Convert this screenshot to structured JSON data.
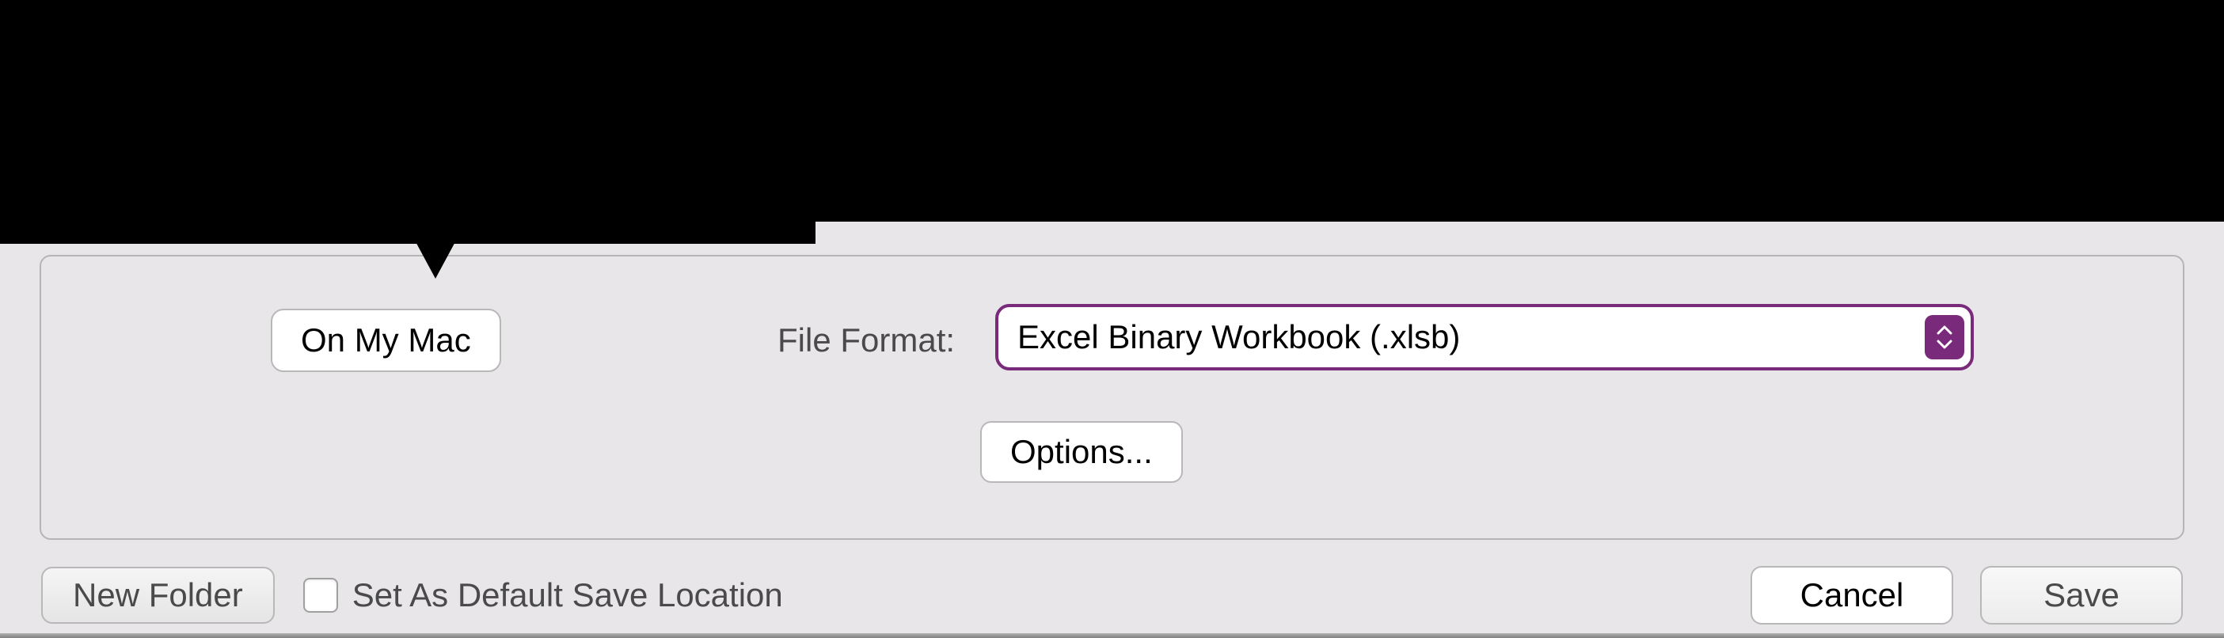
{
  "dialog": {
    "on_my_mac_label": "On My Mac",
    "file_format_label": "File Format:",
    "file_format_value": "Excel Binary Workbook (.xlsb)",
    "options_label": "Options...",
    "new_folder_label": "New Folder",
    "default_location_label": "Set As Default Save Location",
    "cancel_label": "Cancel",
    "save_label": "Save"
  }
}
